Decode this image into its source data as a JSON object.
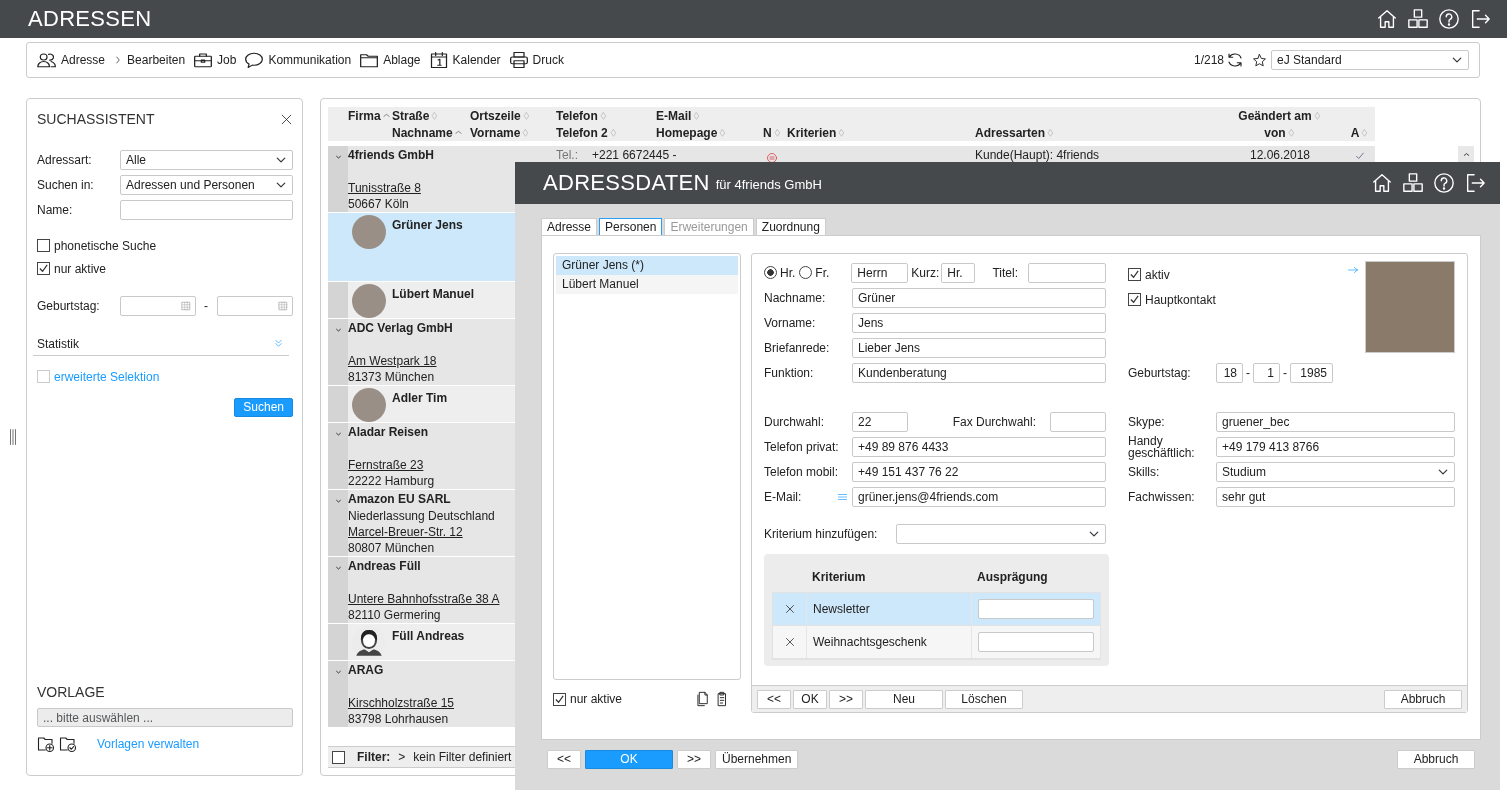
{
  "app": {
    "title": "ADRESSEN"
  },
  "toolbar": {
    "items": [
      {
        "kind": "address",
        "label": "Adresse"
      },
      {
        "kind": "edit",
        "label": "Bearbeiten"
      },
      {
        "kind": "job",
        "label": "Job"
      },
      {
        "kind": "communication",
        "label": "Kommunikation"
      },
      {
        "kind": "filing",
        "label": "Ablage"
      },
      {
        "kind": "calendar",
        "label": "Kalender"
      },
      {
        "kind": "print",
        "label": "Druck"
      }
    ],
    "counter": "1/218",
    "view": "eJ Standard"
  },
  "search": {
    "title": "SUCHASSISTENT",
    "fields": [
      {
        "kind": "select",
        "label": "Adressart:",
        "value": "Alle"
      },
      {
        "kind": "select",
        "label": "Suchen in:",
        "value": "Adressen und Personen"
      },
      {
        "kind": "text",
        "label": "Name:"
      }
    ],
    "options": [
      {
        "label": "phonetische Suche",
        "checked": false
      },
      {
        "label": "nur aktive",
        "checked": true
      }
    ],
    "birthday": {
      "label": "Geburtstag:",
      "separator": "-"
    },
    "statistics": {
      "label": "Statistik",
      "expanded": false
    },
    "extended": {
      "label": "erweiterte Selektion",
      "checked": false
    },
    "search_button": "Suchen",
    "template": {
      "title": "VORLAGE",
      "placeholder": "... bitte auswählen ...",
      "manage_link": "Vorlagen verwalten"
    }
  },
  "table": {
    "columns": [
      {
        "top": {
          "label": "Firma",
          "sorted": true
        }
      },
      {
        "top": {
          "label": "Straße",
          "sorted": false
        },
        "bottom": {
          "label": "Nachname",
          "sorted": true
        }
      },
      {
        "top": {
          "label": "Ortszeile",
          "sorted": false
        },
        "bottom": {
          "label": "Vorname",
          "sorted": false
        }
      },
      {
        "top": {
          "label": "Telefon",
          "sorted": false
        },
        "bottom": {
          "label": "Telefon 2",
          "sorted": false
        }
      },
      {
        "top": {
          "label": "E-Mail",
          "sorted": false
        },
        "bottom": {
          "label": "Homepage",
          "sorted": false
        }
      },
      {
        "bottom": {
          "label": "N",
          "sorted": false
        }
      },
      {
        "bottom": {
          "label": "Kriterien",
          "sorted": false
        }
      },
      {
        "bottom": {
          "label": "Adressarten",
          "sorted": false
        }
      },
      {
        "top": {
          "label": "Geändert am",
          "sorted": false
        },
        "bottom": {
          "label": "von",
          "sorted": false
        }
      },
      {
        "bottom": {
          "label": "A",
          "sorted": false
        }
      }
    ],
    "rows": [
      {
        "kind": "company",
        "name": "4friends GmbH",
        "expanded": true,
        "street": "Tunisstraße 8",
        "city": "50667 Köln",
        "phone_label": "Tel.:",
        "phone": "+221 6672445 -",
        "note": true,
        "address_types": "Kunde(Haupt): 4friends",
        "changed": "12.06.2018",
        "active": true
      },
      {
        "kind": "person",
        "name": "Grüner Jens",
        "photo": true,
        "selected": true
      },
      {
        "kind": "person",
        "name": "Lübert Manuel",
        "photo": true,
        "selected": false
      },
      {
        "kind": "company",
        "name": "ADC Verlag GmbH",
        "expanded": true,
        "street": "Am Westpark 18",
        "city": "81373 München"
      },
      {
        "kind": "person",
        "name": "Adler Tim",
        "photo": true,
        "selected": false
      },
      {
        "kind": "company",
        "name": "Aladar Reisen",
        "expanded": true,
        "street": "Fernstraße 23",
        "city": "22222 Hamburg"
      },
      {
        "kind": "company",
        "name": "Amazon EU SARL",
        "expanded": true,
        "extra": "Niederlassung Deutschland",
        "street": "Marcel-Breuer-Str. 12",
        "city": "80807 München"
      },
      {
        "kind": "company",
        "name": "Andreas Füll",
        "expanded": true,
        "street": "Untere Bahnhofsstraße 38 A",
        "city": "82110 Germering"
      },
      {
        "kind": "person",
        "name": "Füll Andreas",
        "photo": false,
        "selected": false
      },
      {
        "kind": "company",
        "name": "ARAG",
        "expanded": true,
        "street": "Kirschholzstraße 15",
        "city": "83798 Lohrhausen"
      }
    ],
    "filter": {
      "checked": false,
      "label": "Filter:",
      "separator": ">",
      "value": "kein Filter definiert"
    }
  },
  "dialog": {
    "title": "ADRESSDATEN",
    "subtitle": "für 4friends GmbH",
    "tabs": [
      {
        "label": "Adresse",
        "selected": false,
        "disabled": false
      },
      {
        "label": "Personen",
        "selected": true,
        "disabled": false
      },
      {
        "label": "Erweiterungen",
        "selected": false,
        "disabled": true
      },
      {
        "label": "Zuordnung",
        "selected": false,
        "disabled": false
      }
    ],
    "persons": [
      {
        "name": "Grüner Jens (*)",
        "selected": true
      },
      {
        "name": "Lübert Manuel",
        "selected": false
      }
    ],
    "only_active": {
      "label": "nur aktive",
      "checked": true
    },
    "form": {
      "salutations": [
        {
          "label": "Hr.",
          "selected": true
        },
        {
          "label": "Fr.",
          "selected": false
        }
      ],
      "letter_salutation": "Herrn",
      "short_label": "Kurz:",
      "short_value": "Hr.",
      "title_label": "Titel:",
      "fields": [
        {
          "label": "Nachname:",
          "value": "Grüner"
        },
        {
          "label": "Vorname:",
          "value": "Jens"
        },
        {
          "label": "Briefanrede:",
          "value": "Lieber Jens"
        },
        {
          "label": "Funktion:",
          "value": "Kundenberatung"
        }
      ],
      "flags": [
        {
          "label": "aktiv",
          "checked": true
        },
        {
          "label": "Hauptkontakt",
          "checked": true
        }
      ],
      "birthday": {
        "label": "Geburtstag:",
        "day": "18",
        "month": "1",
        "year": "1985",
        "separators": [
          "-",
          "-"
        ]
      },
      "extension": {
        "label": "Durchwahl:",
        "value": "22"
      },
      "fax": {
        "label": "Fax Durchwahl:"
      },
      "contact_fields": [
        {
          "kind": "text",
          "label": "Telefon privat:",
          "value": "+49 89 876 4433"
        },
        {
          "kind": "text",
          "label": "Telefon mobil:",
          "value": "+49 151 437 76 22"
        },
        {
          "kind": "email",
          "label": "E-Mail:",
          "value": "grüner.jens@4friends.com"
        }
      ],
      "side_fields": [
        {
          "kind": "text",
          "label": "Skype:",
          "value": "gruener_bec"
        },
        {
          "kind": "text",
          "label": "Handy geschäftlich:",
          "value": "+49 179 413 8766"
        },
        {
          "kind": "select",
          "label": "Skills:",
          "value": "Studium"
        },
        {
          "kind": "text",
          "label": "Fachwissen:",
          "value": "sehr gut"
        }
      ],
      "criterion_add": {
        "label": "Kriterium hinzufügen:"
      },
      "criteria": {
        "columns": [
          "Kriterium",
          "Ausprägung"
        ],
        "rows": [
          {
            "name": "Newsletter",
            "selected": true
          },
          {
            "name": "Weihnachtsgeschenk",
            "selected": false
          }
        ]
      }
    },
    "form_buttons": [
      {
        "kind": "default",
        "label": "<<"
      },
      {
        "kind": "default",
        "label": "OK"
      },
      {
        "kind": "default",
        "label": ">>"
      },
      {
        "kind": "default",
        "label": "Neu"
      },
      {
        "kind": "default",
        "label": "Löschen"
      },
      {
        "kind": "cancel",
        "label": "Abbruch"
      }
    ],
    "buttons": [
      {
        "kind": "default",
        "label": "<<"
      },
      {
        "kind": "primary",
        "label": "OK"
      },
      {
        "kind": "default",
        "label": ">>"
      },
      {
        "kind": "default",
        "label": "Übernehmen"
      },
      {
        "kind": "cancel",
        "label": "Abbruch"
      }
    ]
  }
}
